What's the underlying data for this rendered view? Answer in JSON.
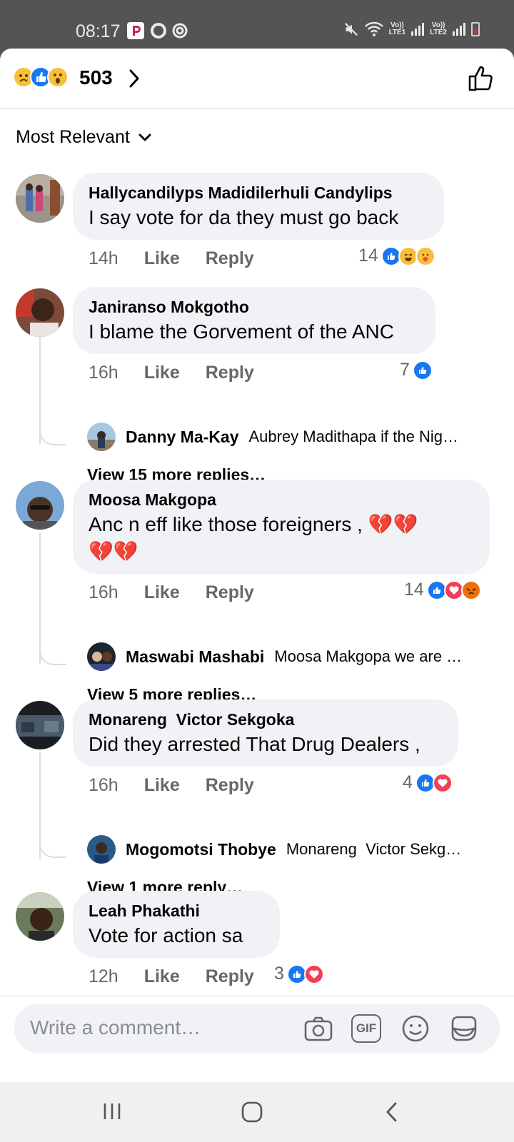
{
  "status": {
    "time": "08:17",
    "lte1": "Vo))\nLTE1",
    "lte2": "Vo))\nLTE2"
  },
  "header": {
    "reaction_icons": [
      "sad-icon",
      "like-icon",
      "wow-icon"
    ],
    "total_reactions": "503"
  },
  "sort": {
    "label": "Most Relevant"
  },
  "comments": [
    {
      "author": "Hallycandilyps Madidilerhuli Candylips",
      "text": "I say vote for da they must go back",
      "time": "14h",
      "like": "Like",
      "reply": "Reply",
      "reaction_count": "14",
      "reactions": [
        "like",
        "haha",
        "care"
      ]
    },
    {
      "author": "Janiranso Mokgotho",
      "text": "I blame the Gorvement of the ANC",
      "time": "16h",
      "like": "Like",
      "reply": "Reply",
      "reaction_count": "7",
      "reactions": [
        "like"
      ],
      "reply_preview": {
        "author": "Danny Ma-Kay",
        "text": "Aubrey Madithapa if the Nig…"
      },
      "view_more": "View 15 more replies…"
    },
    {
      "author": "Moosa Makgopa",
      "text_line1": "Anc n eff like those foreigners  ,",
      "text_line1_emoji": "💔💔",
      "text_line2_emoji": "💔💔",
      "time": "16h",
      "like": "Like",
      "reply": "Reply",
      "reaction_count": "14",
      "reactions": [
        "like",
        "love",
        "angry"
      ],
      "reply_preview": {
        "author": "Maswabi Mashabi",
        "text": "Moosa Makgopa we are …"
      },
      "view_more": "View 5 more replies…"
    },
    {
      "author": "Monareng  Victor Sekgoka",
      "text": "Did they arrested That Drug Dealers ,",
      "time": "16h",
      "like": "Like",
      "reply": "Reply",
      "reaction_count": "4",
      "reactions": [
        "like",
        "love"
      ],
      "reply_preview": {
        "author": "Mogomotsi Thobye",
        "text": "Monareng  Victor Sekg…"
      },
      "view_more": "View 1 more reply…"
    },
    {
      "author": "Leah Phakathi",
      "text": "Vote for action sa",
      "time": "12h",
      "like": "Like",
      "reply": "Reply",
      "reaction_count": "3",
      "reactions": [
        "like",
        "love"
      ]
    }
  ],
  "composer": {
    "placeholder": "Write a comment…",
    "icons": [
      "camera-icon",
      "gif-icon",
      "emoji-icon",
      "sticker-icon"
    ],
    "gif_label": "GIF"
  },
  "colors": {
    "like_blue": "#1877f2",
    "love_red": "#f33e58",
    "emoji_yellow": "#f7c03b",
    "bubble_bg": "#f0f2f5",
    "meta_grey": "#65676b"
  }
}
